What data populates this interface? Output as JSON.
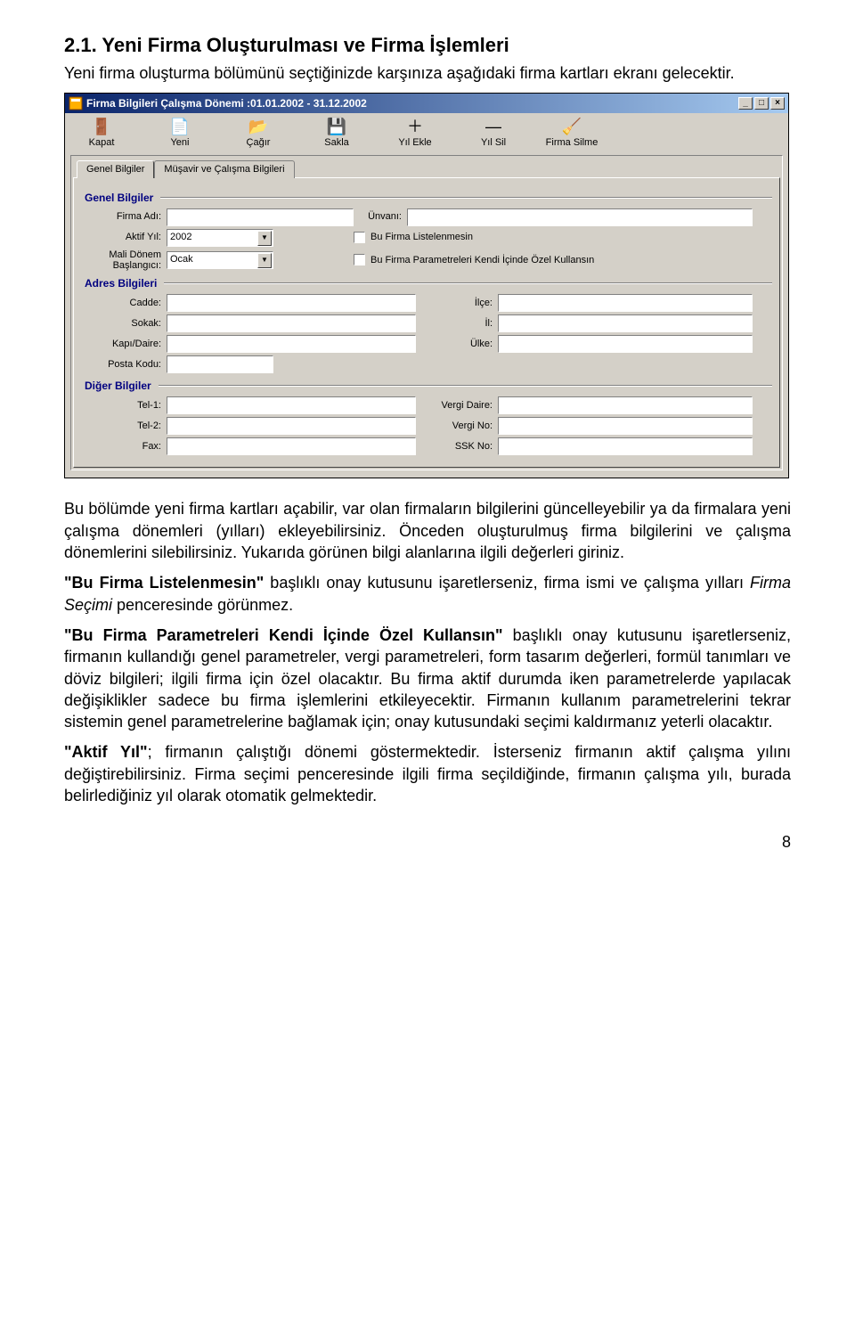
{
  "section": {
    "heading": "2.1. Yeni Firma Oluşturulması ve Firma İşlemleri",
    "intro": "Yeni firma oluşturma bölümünü seçtiğinizde karşınıza aşağıdaki firma kartları ekranı gelecektir."
  },
  "window": {
    "title": "Firma Bilgileri Çalışma Dönemi :01.01.2002 - 31.12.2002",
    "buttons": {
      "min": "_",
      "max": "□",
      "close": "×"
    },
    "toolbar": [
      {
        "name": "kapat",
        "label": "Kapat",
        "glyph": "🚪"
      },
      {
        "name": "yeni",
        "label": "Yeni",
        "glyph": "📄"
      },
      {
        "name": "cagir",
        "label": "Çağır",
        "glyph": "📂"
      },
      {
        "name": "sakla",
        "label": "Sakla",
        "glyph": "💾"
      },
      {
        "name": "yilekle",
        "label": "Yıl Ekle",
        "glyph": "＋"
      },
      {
        "name": "yilsil",
        "label": "Yıl Sil",
        "glyph": "—"
      },
      {
        "name": "firmasilme",
        "label": "Firma Silme",
        "glyph": "🧹"
      }
    ],
    "tabs": {
      "active": "Genel Bilgiler",
      "other": "Müşavir ve Çalışma Bilgileri"
    },
    "groups": {
      "genel": "Genel Bilgiler",
      "adres": "Adres Bilgileri",
      "diger": "Diğer Bilgiler"
    },
    "fields": {
      "firma_adi_label": "Firma Adı:",
      "unvani_label": "Ünvanı:",
      "aktif_yil_label": "Aktif Yıl:",
      "aktif_yil_value": "2002",
      "mali_donem_label": "Mali Dönem Başlangıcı:",
      "mali_donem_value": "Ocak",
      "chk_listelenmesin": "Bu Firma Listelenmesin",
      "chk_ozel": "Bu Firma Parametreleri Kendi İçinde Özel Kullansın",
      "cadde_label": "Cadde:",
      "ilce_label": "İlçe:",
      "sokak_label": "Sokak:",
      "il_label": "İl:",
      "kapi_label": "Kapı/Daire:",
      "ulke_label": "Ülke:",
      "posta_label": "Posta Kodu:",
      "tel1_label": "Tel-1:",
      "vergidaire_label": "Vergi Daire:",
      "tel2_label": "Tel-2:",
      "vergino_label": "Vergi No:",
      "fax_label": "Fax:",
      "sskno_label": "SSK No:"
    }
  },
  "body": {
    "p1": "Bu bölümde yeni firma kartları açabilir, var olan firmaların bilgilerini güncelleyebilir ya da firmalara yeni çalışma dönemleri (yılları) ekleyebilirsiniz. Önceden oluşturulmuş firma bilgilerini ve çalışma dönemlerini silebilirsiniz. Yukarıda görünen bilgi alanlarına ilgili değerleri giriniz.",
    "p2_bold": "\"Bu Firma Listelenmesin\"",
    "p2_rest1": " başlıklı onay kutusunu işaretlerseniz, firma ismi ve çalışma yılları ",
    "p2_italic": "Firma Seçimi",
    "p2_rest2": " penceresinde görünmez.",
    "p3_bold": "\"Bu Firma Parametreleri Kendi İçinde Özel Kullansın\"",
    "p3_rest": " başlıklı onay kutusunu işaretlerseniz, firmanın kullandığı genel parametreler, vergi parametreleri, form tasarım değerleri, formül tanımları ve döviz bilgileri; ilgili firma için özel olacaktır. Bu firma aktif durumda iken parametrelerde yapılacak değişiklikler sadece bu firma işlemlerini etkileyecektir. Firmanın kullanım parametrelerini tekrar sistemin genel parametrelerine bağlamak için; onay kutusundaki seçimi kaldırmanız yeterli olacaktır.",
    "p4_bold": "\"Aktif Yıl\"",
    "p4_rest": "; firmanın çalıştığı dönemi göstermektedir. İsterseniz firmanın aktif çalışma yılını değiştirebilirsiniz. Firma seçimi penceresinde ilgili firma seçildiğinde, firmanın çalışma yılı, burada belirlediğiniz yıl olarak otomatik gelmektedir."
  },
  "page_number": "8"
}
